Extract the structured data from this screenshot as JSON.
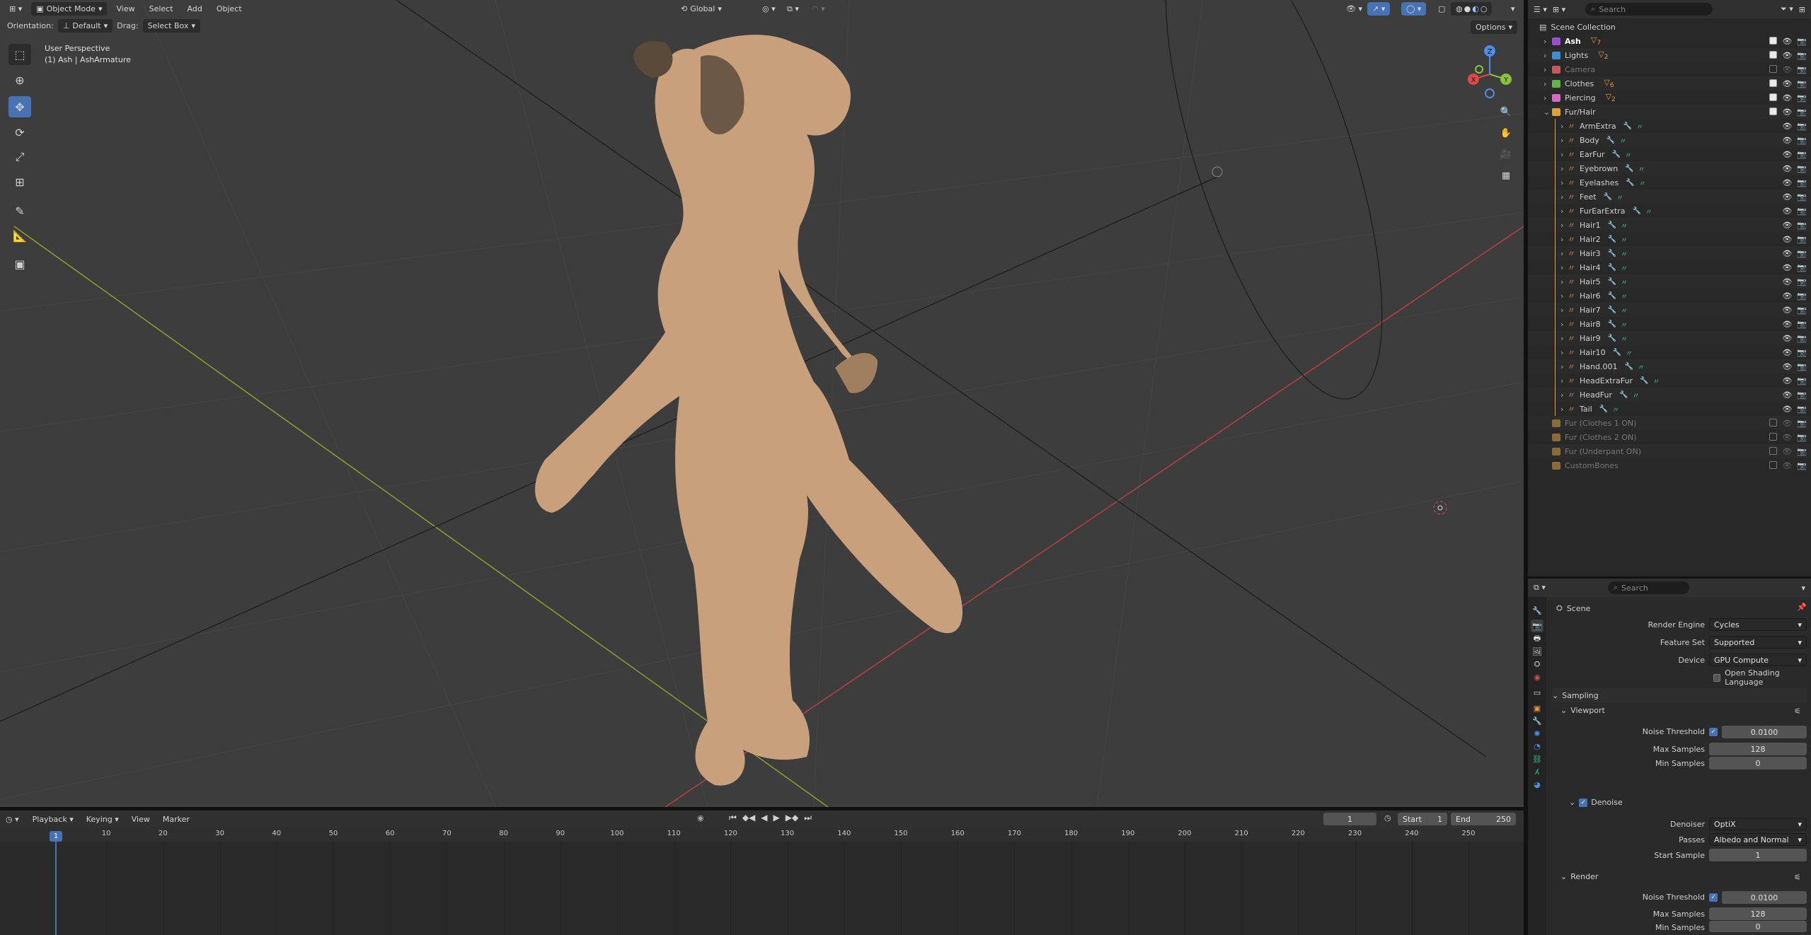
{
  "viewport": {
    "mode": "Object Mode",
    "menus": [
      "View",
      "Select",
      "Add",
      "Object"
    ],
    "orientation_label": "Orientation:",
    "orientation_value": "Default",
    "drag_label": "Drag:",
    "drag_value": "Select Box",
    "transform_orientation": "Global",
    "options": "Options",
    "overlay_title": "User Perspective",
    "overlay_subtitle": "(1) Ash | AshArmature",
    "search_placeholder": "Search",
    "gizmo": {
      "x": "X",
      "y": "Y",
      "z": "Z"
    }
  },
  "outliner": {
    "search_placeholder": "Search",
    "title": "Scene Collection",
    "top_collections": [
      {
        "label": "Ash",
        "color": "#9a4fd0",
        "bold": true,
        "badge": "7"
      },
      {
        "label": "Lights",
        "color": "#3d8fd6",
        "badge": "2"
      },
      {
        "label": "Camera",
        "color": "#c65a5a",
        "dim": true
      },
      {
        "label": "Clothes",
        "color": "#5fb34a",
        "badge": "6"
      },
      {
        "label": "Piercing",
        "color": "#d56ac4",
        "badge": "2"
      },
      {
        "label": "Fur/Hair",
        "color": "#e0a13a",
        "badge": ""
      }
    ],
    "fur_items": [
      "ArmExtra",
      "Body",
      "EarFur",
      "Eyebrown",
      "Eyelashes",
      "Feet",
      "FurEarExtra",
      "Hair1",
      "Hair2",
      "Hair3",
      "Hair4",
      "Hair5",
      "Hair6",
      "Hair7",
      "Hair8",
      "Hair9",
      "Hair10",
      "Hand.001",
      "HeadExtraFur",
      "HeadFur",
      "Tail"
    ],
    "bottom_collections": [
      "Fur (Clothes 1 ON)",
      "Fur (Clothes 2 ON)",
      "Fur (Underpant ON)",
      "CustomBones"
    ]
  },
  "properties": {
    "search_placeholder": "Search",
    "scene_label": "Scene",
    "render_engine_label": "Render Engine",
    "render_engine": "Cycles",
    "feature_set_label": "Feature Set",
    "feature_set": "Supported",
    "device_label": "Device",
    "device": "GPU Compute",
    "osl_label": "Open Shading Language",
    "sampling": "Sampling",
    "viewport_section": "Viewport",
    "noise_threshold_label": "Noise Threshold",
    "vp_noise_threshold": "0.0100",
    "max_samples_label": "Max Samples",
    "vp_max_samples": "128",
    "min_samples_label": "Min Samples",
    "vp_min_samples": "0",
    "denoise": "Denoise",
    "denoiser_label": "Denoiser",
    "denoiser": "OptiX",
    "passes_label": "Passes",
    "passes": "Albedo and Normal",
    "start_sample_label": "Start Sample",
    "start_sample": "1",
    "render_section": "Render",
    "r_noise_threshold": "0.0100",
    "r_max_samples": "128",
    "r_min_samples": "0"
  },
  "timeline": {
    "menus": [
      "Playback",
      "Keying",
      "View",
      "Marker"
    ],
    "current_frame": "1",
    "start_label": "Start",
    "start": "1",
    "end_label": "End",
    "end": "250",
    "ticks": [
      "10",
      "20",
      "30",
      "40",
      "50",
      "60",
      "70",
      "80",
      "90",
      "100",
      "110",
      "120",
      "130",
      "140",
      "150",
      "160",
      "170",
      "180",
      "190",
      "200",
      "210",
      "220",
      "230",
      "240",
      "250"
    ],
    "playhead": "1"
  }
}
